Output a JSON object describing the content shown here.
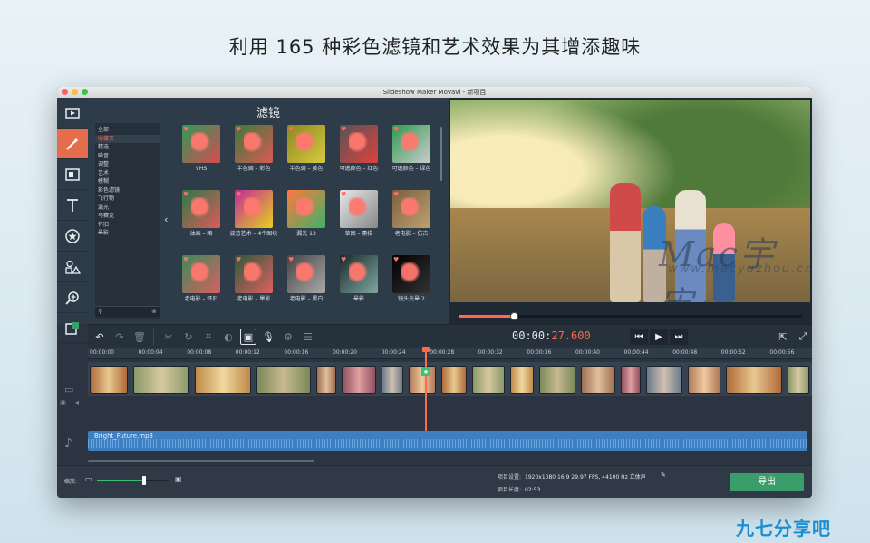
{
  "headline": "利用 165 种彩色滤镜和艺术效果为其增添趣味",
  "window": {
    "title": "Slideshow Maker Movavi - 新项目"
  },
  "sidebar": {
    "items": [
      {
        "name": "media",
        "icon": "film-icon"
      },
      {
        "name": "filters",
        "icon": "magic-wand-icon",
        "active": true
      },
      {
        "name": "transitions",
        "icon": "transition-icon"
      },
      {
        "name": "titles",
        "icon": "text-icon"
      },
      {
        "name": "stickers",
        "icon": "star-icon"
      },
      {
        "name": "shapes",
        "icon": "shapes-icon"
      },
      {
        "name": "zoom",
        "icon": "zoom-icon"
      },
      {
        "name": "more",
        "icon": "more-icon"
      }
    ]
  },
  "filters_panel": {
    "title": "滤镜",
    "categories": [
      "全部",
      "收藏夹",
      "精选",
      "噪音",
      "调整",
      "艺术",
      "模糊",
      "彩色滤镜",
      "飞行物",
      "漏光",
      "马赛克",
      "怀旧",
      "晕影"
    ],
    "selected_category": "收藏夹",
    "items": [
      {
        "label": "VHS",
        "colors": [
          "#2d9a5a",
          "#d84a50"
        ]
      },
      {
        "label": "半色调 – 彩色",
        "colors": [
          "#3a7a3a",
          "#d95a55"
        ]
      },
      {
        "label": "半色调 – 黄色",
        "colors": [
          "#8a8a20",
          "#d8c840"
        ]
      },
      {
        "label": "可选颜色 – 红色",
        "colors": [
          "#555",
          "#e04040"
        ]
      },
      {
        "label": "可选颜色 – 绿色",
        "colors": [
          "#2f9a4f",
          "#cccccc"
        ]
      },
      {
        "label": "油画 – 暗",
        "colors": [
          "#2a7a4a",
          "#e05a58"
        ]
      },
      {
        "label": "波普艺术 – 4个图块",
        "colors": [
          "#c02a9a",
          "#e8d020"
        ]
      },
      {
        "label": "漏光 13",
        "colors": [
          "#ff7a3a",
          "#3ab26a"
        ]
      },
      {
        "label": "草图 – 素描",
        "colors": [
          "#e8e8e8",
          "#888"
        ]
      },
      {
        "label": "老电影 – 仿古",
        "colors": [
          "#7a6040",
          "#c0a070"
        ]
      },
      {
        "label": "老电影 – 怀旧",
        "colors": [
          "#3a8a5a",
          "#d86060"
        ]
      },
      {
        "label": "老电影 – 暈影",
        "colors": [
          "#2a5a3a",
          "#e06060"
        ]
      },
      {
        "label": "老电影 – 黑白",
        "colors": [
          "#444",
          "#aaa"
        ]
      },
      {
        "label": "晕影",
        "colors": [
          "#1a2a2a",
          "#7fa8a0"
        ]
      },
      {
        "label": "镜头光晕 2",
        "colors": [
          "#000",
          "#333"
        ]
      }
    ]
  },
  "preview": {
    "watermark": "Mac宇宙",
    "watermark_sub": "www.macyuzhou.cn",
    "progress": 0.16
  },
  "toolbar": {
    "timecode_main": "00:00:",
    "timecode_accent": "27.600"
  },
  "timeline": {
    "ticks": [
      "00:00:00",
      "00:00:04",
      "00:00:08",
      "00:00:12",
      "00:00:16",
      "00:00:20",
      "00:00:24",
      "00:00:28",
      "00:00:32",
      "00:00:36",
      "00:00:40",
      "00:00:44",
      "00:00:48",
      "00:00:52",
      "00:00:56"
    ],
    "audio_label": "Bright_Future.mp3"
  },
  "status": {
    "zoom_label": "缩放:",
    "zoom_value": 0.65,
    "settings_label": "项目设置:",
    "settings_value": "1920x1080 16:9 29.97 FPS, 44100 Hz 立体声",
    "length_label": "项目长度:",
    "length_value": "02:53",
    "export_label": "导出"
  },
  "site_logo": "九七分享吧",
  "colors": {
    "accent": "#ff6a4a",
    "export": "#3a9d6a",
    "audio": "#3d7fc0"
  }
}
